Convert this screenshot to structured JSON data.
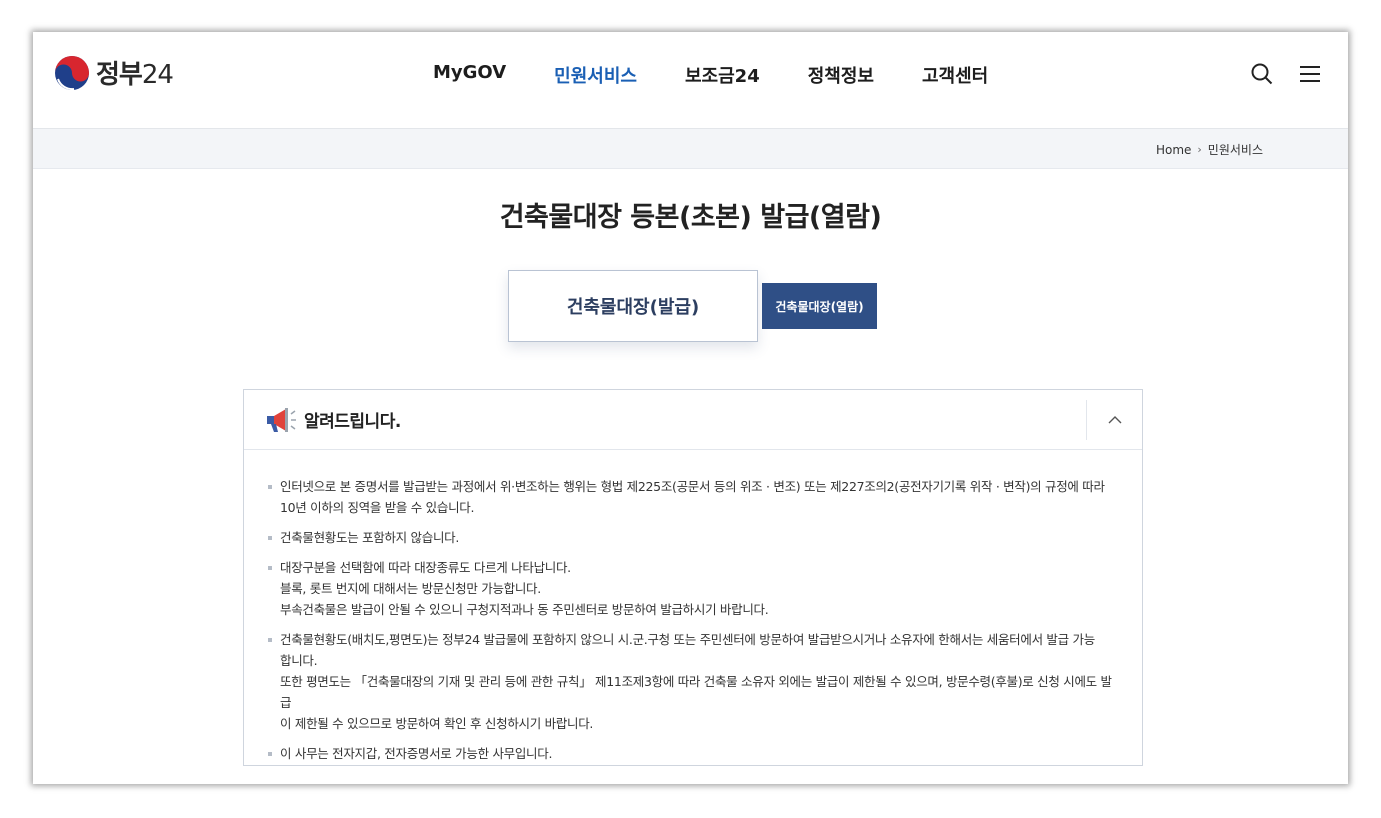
{
  "header": {
    "logo_text": "정부",
    "logo_num": "24",
    "nav": [
      {
        "label": "MyGOV",
        "active": false
      },
      {
        "label": "민원서비스",
        "active": true
      },
      {
        "label": "보조금24",
        "active": false
      },
      {
        "label": "정책정보",
        "active": false
      },
      {
        "label": "고객센터",
        "active": false
      }
    ],
    "icons": [
      "search-icon",
      "menu-icon"
    ]
  },
  "breadcrumb": {
    "home": "Home",
    "current": "민원서비스"
  },
  "page_title": "건축물대장 등본(초본) 발급(열람)",
  "tabs": {
    "primary": "건축물대장(발급)",
    "secondary": "건축물대장(열람)"
  },
  "notice": {
    "icon": "megaphone-icon",
    "title": "알려드립니다.",
    "items": [
      {
        "lines": [
          "인터넷으로 본 증명서를 발급받는 과정에서 위·변조하는 행위는 형법 제225조(공문서 등의 위조 · 변조) 또는 제227조의2(공전자기기록 위작 · 변작)의 규정에 따라",
          "10년 이하의 징역을 받을 수 있습니다."
        ]
      },
      {
        "lines": [
          "건축물현황도는 포함하지 않습니다."
        ]
      },
      {
        "lines": [
          "대장구분을 선택함에 따라 대장종류도 다르게 나타납니다.",
          "블록, 롯트 번지에 대해서는 방문신청만 가능합니다.",
          "부속건축물은 발급이 안될 수 있으니 구청지적과나 동 주민센터로 방문하여 발급하시기 바랍니다."
        ]
      },
      {
        "lines": [
          "건축물현황도(배치도,평면도)는 정부24 발급물에 포함하지 않으니 시.군.구청 또는 주민센터에 방문하여 발급받으시거나 소유자에 한해서는 세움터에서 발급 가능",
          "합니다.",
          "또한 평면도는 「건축물대장의 기재 및 관리 등에 관한 규칙」 제11조제3항에 따라 건축물 소유자 외에는 발급이 제한될 수 있으며, 방문수령(후불)로 신청 시에도 발급",
          "이 제한될 수 있으므로 방문하여 확인 후 신청하시기 바랍니다."
        ]
      },
      {
        "lines": [
          "이 사무는 전자지갑, 전자증명서로 가능한 사무입니다."
        ]
      }
    ]
  },
  "colors": {
    "accent": "#1a5fb4",
    "tab_active_bg": "#2f4f86",
    "crumb_bg": "#f3f5f8"
  }
}
